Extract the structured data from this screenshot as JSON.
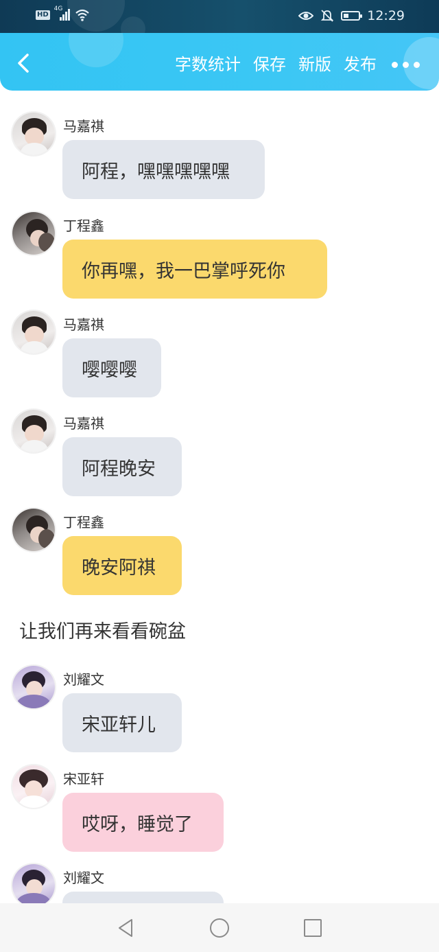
{
  "status_bar": {
    "hd_label": "HD",
    "network_label": "4G",
    "time": "12:29",
    "battery_level": 0.35,
    "icons": [
      "signal-icon",
      "wifi-icon",
      "eye-icon",
      "bell-off-icon",
      "battery-icon"
    ]
  },
  "header": {
    "back_icon": "chevron-left-icon",
    "actions": [
      "字数统计",
      "保存",
      "新版",
      "发布"
    ],
    "more_icon": "more-dots-icon",
    "accent_color": "#33c4f3"
  },
  "messages": [
    {
      "sender": "马嘉祺",
      "text": "阿程，嘿嘿嘿嘿嘿",
      "bubble_color": "#e2e6ed"
    },
    {
      "sender": "丁程鑫",
      "text": "你再嘿，我一巴掌呼死你",
      "bubble_color": "#fbd96d"
    },
    {
      "sender": "马嘉祺",
      "text": "嘤嘤嘤",
      "bubble_color": "#e2e6ed"
    },
    {
      "sender": "马嘉祺",
      "text": "阿程晚安",
      "bubble_color": "#e2e6ed"
    },
    {
      "sender": "丁程鑫",
      "text": "晚安阿祺",
      "bubble_color": "#fbd96d"
    }
  ],
  "narration": "让我们再来看看碗盆",
  "messages_2": [
    {
      "sender": "刘耀文",
      "text": "宋亚轩儿",
      "bubble_color": "#e2e6ed"
    },
    {
      "sender": "宋亚轩",
      "text": "哎呀，睡觉了",
      "bubble_color": "#fbd0dc"
    },
    {
      "sender": "刘耀文",
      "text": "",
      "bubble_color": "#e2e6ed"
    }
  ],
  "nav": {
    "icons": [
      "back-triangle-icon",
      "home-circle-icon",
      "recents-square-icon"
    ]
  }
}
